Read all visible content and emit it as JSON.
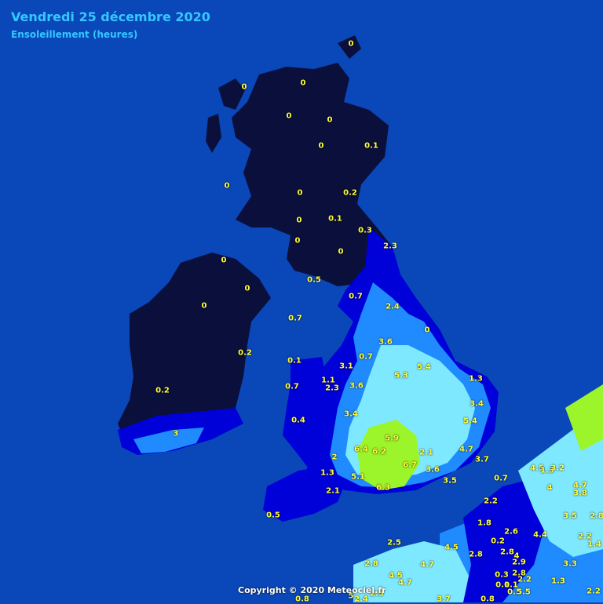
{
  "header": {
    "title": "Vendredi 25 décembre 2020",
    "subtitle": "Ensoleillement (heures)"
  },
  "footer": {
    "copyright": "Copyright © 2020 Meteociel.fr"
  },
  "colors": {
    "sea": "#0a47b8",
    "land_no_sun": "#0b0f3c",
    "low": "#0000d8",
    "medium": "#1f8bff",
    "high": "#7ee8ff",
    "peak": "#9cf52a",
    "label": "#ffff3a"
  },
  "station_values": [
    "0",
    "0",
    "0",
    "0",
    "0",
    "0",
    "0.1",
    "0",
    "0",
    "0.2",
    "0",
    "0.1",
    "0.3",
    "0",
    "0",
    "2.3",
    "0",
    "0.5",
    "0.7",
    "0",
    "0.7",
    "2.4",
    "0",
    "0.2",
    "0",
    "3.6",
    "0.1",
    "3.1",
    "0.7",
    "5.4",
    "5.3",
    "1.3",
    "0.2",
    "1.1",
    "2.3",
    "3.6",
    "0.7",
    "3.4",
    "3.4",
    "0.4",
    "5.4",
    "3",
    "5.9",
    "6.4",
    "6.2",
    "2.1",
    "4.7",
    "2",
    "3.7",
    "1.3",
    "6.7",
    "3.6",
    "5.1",
    "3.5",
    "0.7",
    "4.5",
    "1.3",
    "3.2",
    "2.1",
    "6.3",
    "4",
    "4.7",
    "3.8",
    "2.2",
    "3.5",
    "2.8",
    "0.5",
    "1.8",
    "2.6",
    "4.4",
    "0.2",
    "2.2",
    "1.4",
    "2.5",
    "4.5",
    "2.8",
    "2.8",
    "4",
    "2.9",
    "4.7",
    "2.8",
    "3.3",
    "0.3",
    "2.8",
    "2.2",
    "1.3",
    "4.5",
    "4.7",
    "0.1",
    "0.1",
    "0.5",
    "5.5",
    "2.2",
    "2.5",
    "0.8",
    "2.4",
    "3.7",
    "0.8",
    "5"
  ]
}
